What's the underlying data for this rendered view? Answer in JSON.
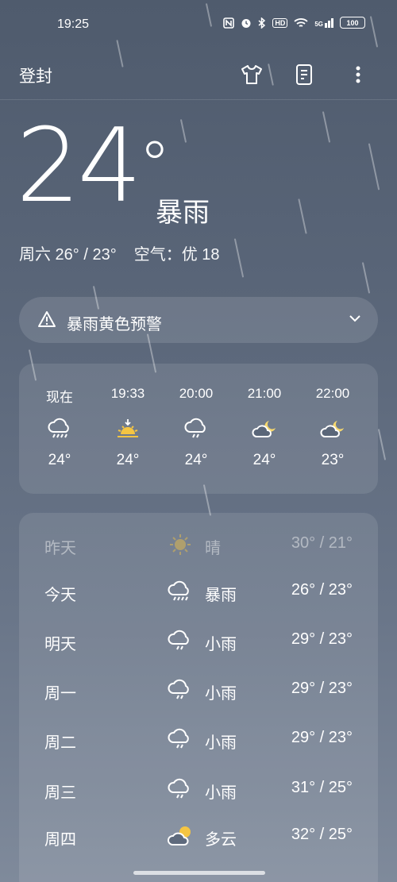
{
  "status_bar": {
    "time": "19:25",
    "icons": [
      "nfc-icon",
      "alarm-icon",
      "bluetooth-icon",
      "hd-icon",
      "wifi-icon",
      "5g-signal-icon"
    ],
    "hd_label": "HD",
    "network_label": "5G",
    "battery": "100"
  },
  "header": {
    "city": "登封",
    "actions": [
      "clothing-icon",
      "document-icon",
      "more-icon"
    ]
  },
  "current": {
    "temperature": "24",
    "degree": "°",
    "condition": "暴雨",
    "today_range": "周六 26° / 23°",
    "air_quality": "空气：优 18"
  },
  "alert": {
    "text": "暴雨黄色预警"
  },
  "hourly": [
    {
      "time": "现在",
      "icon": "heavy-rain-icon",
      "temp": "24°"
    },
    {
      "time": "19:33",
      "icon": "sunset-icon",
      "temp": "24°"
    },
    {
      "time": "20:00",
      "icon": "light-rain-icon",
      "temp": "24°"
    },
    {
      "time": "21:00",
      "icon": "partly-cloudy-night-icon",
      "temp": "24°"
    },
    {
      "time": "22:00",
      "icon": "partly-cloudy-night-icon",
      "temp": "23°"
    }
  ],
  "daily": [
    {
      "day": "昨天",
      "icon": "sunny-icon",
      "condition": "晴",
      "range": "30° / 21°"
    },
    {
      "day": "今天",
      "icon": "heavy-rain-icon",
      "condition": "暴雨",
      "range": "26° / 23°"
    },
    {
      "day": "明天",
      "icon": "light-rain-icon",
      "condition": "小雨",
      "range": "29° / 23°"
    },
    {
      "day": "周一",
      "icon": "light-rain-icon",
      "condition": "小雨",
      "range": "29° / 23°"
    },
    {
      "day": "周二",
      "icon": "light-rain-icon",
      "condition": "小雨",
      "range": "29° / 23°"
    },
    {
      "day": "周三",
      "icon": "light-rain-icon",
      "condition": "小雨",
      "range": "31° / 25°"
    },
    {
      "day": "周四",
      "icon": "partly-cloudy-icon",
      "condition": "多云",
      "range": "32° / 25°"
    }
  ],
  "colors": {
    "sun": "#f5c542",
    "moon": "#f5d76e"
  }
}
